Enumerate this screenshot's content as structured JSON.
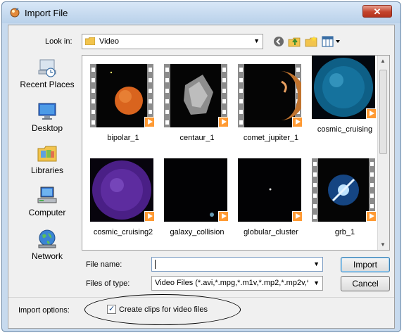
{
  "window": {
    "title": "Import File",
    "close_glyph": "✕"
  },
  "look_in": {
    "label": "Look in:",
    "value": "Video"
  },
  "places": [
    {
      "label": "Recent Places",
      "icon": "recent-places-icon"
    },
    {
      "label": "Desktop",
      "icon": "desktop-icon"
    },
    {
      "label": "Libraries",
      "icon": "libraries-icon"
    },
    {
      "label": "Computer",
      "icon": "computer-icon"
    },
    {
      "label": "Network",
      "icon": "network-icon"
    }
  ],
  "files": [
    {
      "name": "bipolar_1",
      "art": "orange-planet"
    },
    {
      "name": "centaur_1",
      "art": "grey-rock"
    },
    {
      "name": "comet_jupiter_1",
      "art": "jupiter-limb"
    },
    {
      "name": "cosmic_cruising",
      "art": "blue-sphere"
    },
    {
      "name": "cosmic_cruising2",
      "art": "purple-sphere"
    },
    {
      "name": "galaxy_collision",
      "art": "dark-field"
    },
    {
      "name": "globular_cluster",
      "art": "dark-star"
    },
    {
      "name": "grb_1",
      "art": "blue-burst"
    }
  ],
  "form": {
    "file_name_label": "File name:",
    "file_name_value": "",
    "files_of_type_label": "Files of type:",
    "files_of_type_value": "Video Files (*.avi,*.mpg,*.m1v,*.mp2,*.mp2v,*.m"
  },
  "buttons": {
    "import": "Import",
    "cancel": "Cancel"
  },
  "options": {
    "label": "Import options:",
    "create_clips_label": "Create clips for video files",
    "create_clips_checked": true
  },
  "colors": {
    "title_bar": "#c7daee",
    "close_button": "#c4442c",
    "play_badge": "#ff9a33"
  }
}
